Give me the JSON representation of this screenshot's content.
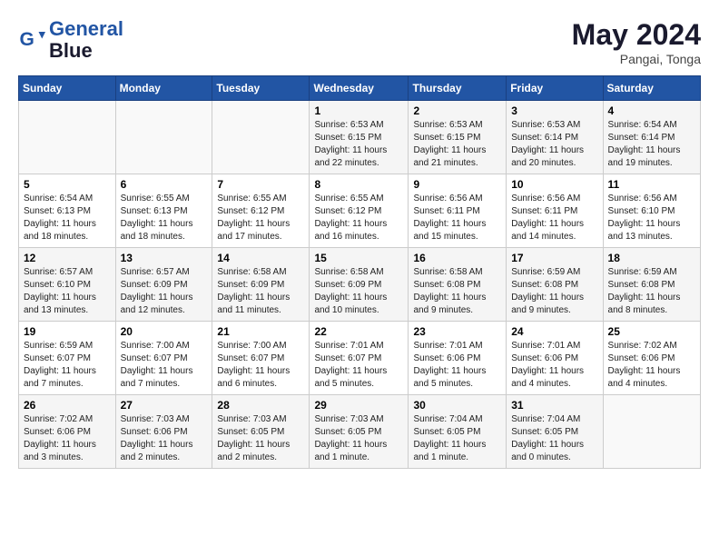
{
  "header": {
    "logo_line1": "General",
    "logo_line2": "Blue",
    "month_year": "May 2024",
    "location": "Pangai, Tonga"
  },
  "days_of_week": [
    "Sunday",
    "Monday",
    "Tuesday",
    "Wednesday",
    "Thursday",
    "Friday",
    "Saturday"
  ],
  "weeks": [
    [
      {
        "day": "",
        "sunrise": "",
        "sunset": "",
        "daylight": ""
      },
      {
        "day": "",
        "sunrise": "",
        "sunset": "",
        "daylight": ""
      },
      {
        "day": "",
        "sunrise": "",
        "sunset": "",
        "daylight": ""
      },
      {
        "day": "1",
        "sunrise": "Sunrise: 6:53 AM",
        "sunset": "Sunset: 6:15 PM",
        "daylight": "Daylight: 11 hours and 22 minutes."
      },
      {
        "day": "2",
        "sunrise": "Sunrise: 6:53 AM",
        "sunset": "Sunset: 6:15 PM",
        "daylight": "Daylight: 11 hours and 21 minutes."
      },
      {
        "day": "3",
        "sunrise": "Sunrise: 6:53 AM",
        "sunset": "Sunset: 6:14 PM",
        "daylight": "Daylight: 11 hours and 20 minutes."
      },
      {
        "day": "4",
        "sunrise": "Sunrise: 6:54 AM",
        "sunset": "Sunset: 6:14 PM",
        "daylight": "Daylight: 11 hours and 19 minutes."
      }
    ],
    [
      {
        "day": "5",
        "sunrise": "Sunrise: 6:54 AM",
        "sunset": "Sunset: 6:13 PM",
        "daylight": "Daylight: 11 hours and 18 minutes."
      },
      {
        "day": "6",
        "sunrise": "Sunrise: 6:55 AM",
        "sunset": "Sunset: 6:13 PM",
        "daylight": "Daylight: 11 hours and 18 minutes."
      },
      {
        "day": "7",
        "sunrise": "Sunrise: 6:55 AM",
        "sunset": "Sunset: 6:12 PM",
        "daylight": "Daylight: 11 hours and 17 minutes."
      },
      {
        "day": "8",
        "sunrise": "Sunrise: 6:55 AM",
        "sunset": "Sunset: 6:12 PM",
        "daylight": "Daylight: 11 hours and 16 minutes."
      },
      {
        "day": "9",
        "sunrise": "Sunrise: 6:56 AM",
        "sunset": "Sunset: 6:11 PM",
        "daylight": "Daylight: 11 hours and 15 minutes."
      },
      {
        "day": "10",
        "sunrise": "Sunrise: 6:56 AM",
        "sunset": "Sunset: 6:11 PM",
        "daylight": "Daylight: 11 hours and 14 minutes."
      },
      {
        "day": "11",
        "sunrise": "Sunrise: 6:56 AM",
        "sunset": "Sunset: 6:10 PM",
        "daylight": "Daylight: 11 hours and 13 minutes."
      }
    ],
    [
      {
        "day": "12",
        "sunrise": "Sunrise: 6:57 AM",
        "sunset": "Sunset: 6:10 PM",
        "daylight": "Daylight: 11 hours and 13 minutes."
      },
      {
        "day": "13",
        "sunrise": "Sunrise: 6:57 AM",
        "sunset": "Sunset: 6:09 PM",
        "daylight": "Daylight: 11 hours and 12 minutes."
      },
      {
        "day": "14",
        "sunrise": "Sunrise: 6:58 AM",
        "sunset": "Sunset: 6:09 PM",
        "daylight": "Daylight: 11 hours and 11 minutes."
      },
      {
        "day": "15",
        "sunrise": "Sunrise: 6:58 AM",
        "sunset": "Sunset: 6:09 PM",
        "daylight": "Daylight: 11 hours and 10 minutes."
      },
      {
        "day": "16",
        "sunrise": "Sunrise: 6:58 AM",
        "sunset": "Sunset: 6:08 PM",
        "daylight": "Daylight: 11 hours and 9 minutes."
      },
      {
        "day": "17",
        "sunrise": "Sunrise: 6:59 AM",
        "sunset": "Sunset: 6:08 PM",
        "daylight": "Daylight: 11 hours and 9 minutes."
      },
      {
        "day": "18",
        "sunrise": "Sunrise: 6:59 AM",
        "sunset": "Sunset: 6:08 PM",
        "daylight": "Daylight: 11 hours and 8 minutes."
      }
    ],
    [
      {
        "day": "19",
        "sunrise": "Sunrise: 6:59 AM",
        "sunset": "Sunset: 6:07 PM",
        "daylight": "Daylight: 11 hours and 7 minutes."
      },
      {
        "day": "20",
        "sunrise": "Sunrise: 7:00 AM",
        "sunset": "Sunset: 6:07 PM",
        "daylight": "Daylight: 11 hours and 7 minutes."
      },
      {
        "day": "21",
        "sunrise": "Sunrise: 7:00 AM",
        "sunset": "Sunset: 6:07 PM",
        "daylight": "Daylight: 11 hours and 6 minutes."
      },
      {
        "day": "22",
        "sunrise": "Sunrise: 7:01 AM",
        "sunset": "Sunset: 6:07 PM",
        "daylight": "Daylight: 11 hours and 5 minutes."
      },
      {
        "day": "23",
        "sunrise": "Sunrise: 7:01 AM",
        "sunset": "Sunset: 6:06 PM",
        "daylight": "Daylight: 11 hours and 5 minutes."
      },
      {
        "day": "24",
        "sunrise": "Sunrise: 7:01 AM",
        "sunset": "Sunset: 6:06 PM",
        "daylight": "Daylight: 11 hours and 4 minutes."
      },
      {
        "day": "25",
        "sunrise": "Sunrise: 7:02 AM",
        "sunset": "Sunset: 6:06 PM",
        "daylight": "Daylight: 11 hours and 4 minutes."
      }
    ],
    [
      {
        "day": "26",
        "sunrise": "Sunrise: 7:02 AM",
        "sunset": "Sunset: 6:06 PM",
        "daylight": "Daylight: 11 hours and 3 minutes."
      },
      {
        "day": "27",
        "sunrise": "Sunrise: 7:03 AM",
        "sunset": "Sunset: 6:06 PM",
        "daylight": "Daylight: 11 hours and 2 minutes."
      },
      {
        "day": "28",
        "sunrise": "Sunrise: 7:03 AM",
        "sunset": "Sunset: 6:05 PM",
        "daylight": "Daylight: 11 hours and 2 minutes."
      },
      {
        "day": "29",
        "sunrise": "Sunrise: 7:03 AM",
        "sunset": "Sunset: 6:05 PM",
        "daylight": "Daylight: 11 hours and 1 minute."
      },
      {
        "day": "30",
        "sunrise": "Sunrise: 7:04 AM",
        "sunset": "Sunset: 6:05 PM",
        "daylight": "Daylight: 11 hours and 1 minute."
      },
      {
        "day": "31",
        "sunrise": "Sunrise: 7:04 AM",
        "sunset": "Sunset: 6:05 PM",
        "daylight": "Daylight: 11 hours and 0 minutes."
      },
      {
        "day": "",
        "sunrise": "",
        "sunset": "",
        "daylight": ""
      }
    ]
  ]
}
